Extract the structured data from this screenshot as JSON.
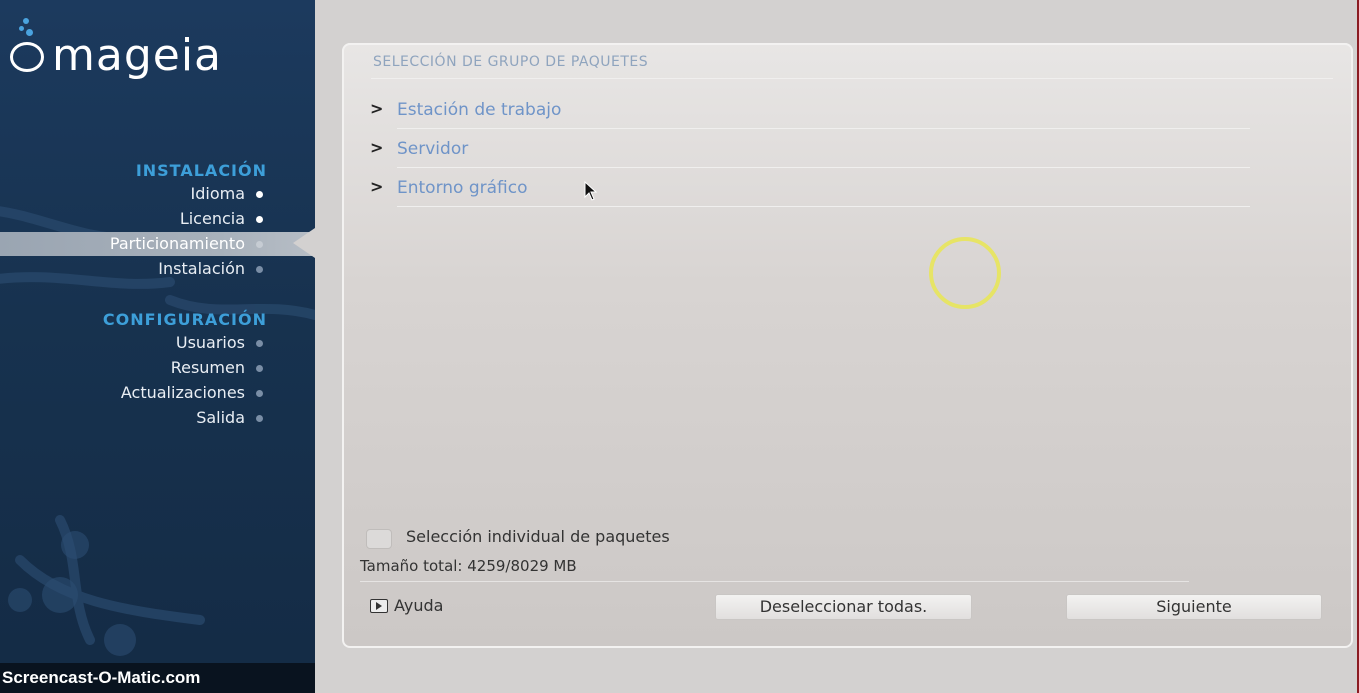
{
  "sidebar": {
    "logo_text": "mageia",
    "sections": [
      {
        "title": "INSTALACIÓN",
        "items": [
          {
            "label": "Idioma",
            "state": "done"
          },
          {
            "label": "Licencia",
            "state": "done"
          },
          {
            "label": "Particionamiento",
            "state": "active"
          },
          {
            "label": "Instalación",
            "state": "pending"
          }
        ]
      },
      {
        "title": "CONFIGURACIÓN",
        "items": [
          {
            "label": "Usuarios",
            "state": "pending"
          },
          {
            "label": "Resumen",
            "state": "pending"
          },
          {
            "label": "Actualizaciones",
            "state": "pending"
          },
          {
            "label": "Salida",
            "state": "pending"
          }
        ]
      }
    ],
    "watermark": "Screencast-O-Matic.com"
  },
  "panel": {
    "title": "SELECCIÓN DE GRUPO DE PAQUETES",
    "groups": [
      {
        "label": "Estación de trabajo"
      },
      {
        "label": "Servidor"
      },
      {
        "label": "Entorno gráfico"
      }
    ],
    "individual_selection_label": "Selección individual de paquetes",
    "total_size": "Tamaño total: 4259/8029 MB",
    "help_label": "Ayuda",
    "deselect_all_label": "Deseleccionar todas.",
    "next_label": "Siguiente"
  },
  "colors": {
    "sidebar_bg": "#17324f",
    "section_title": "#3d9fd9",
    "group_link": "#6f94c8",
    "panel_title": "#8fa4be",
    "loader": "#e8e65a"
  }
}
